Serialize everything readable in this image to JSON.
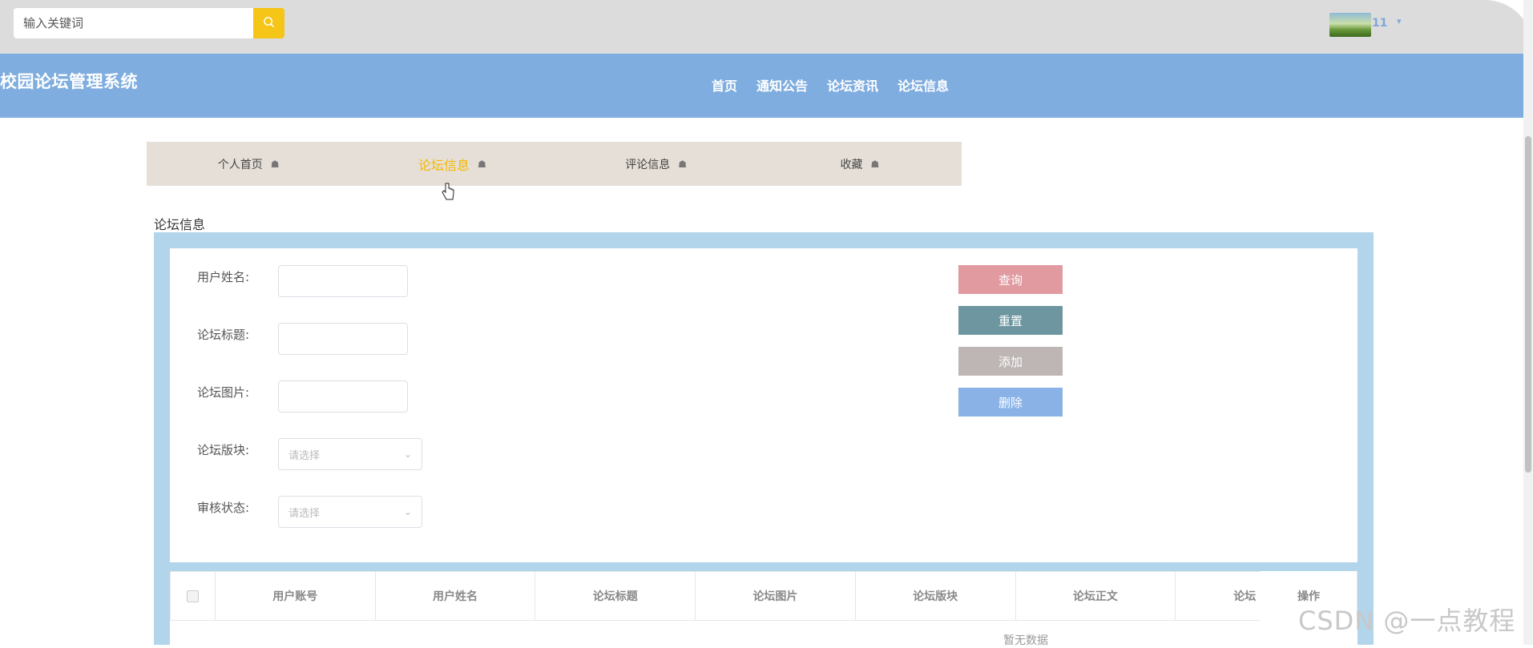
{
  "topbar": {
    "search_placeholder": "输入关键词",
    "user_name": "11"
  },
  "header": {
    "site_title": "校园论坛管理系统",
    "nav": [
      "首页",
      "通知公告",
      "论坛资讯",
      "论坛信息"
    ]
  },
  "subtabs": [
    "个人首页",
    "论坛信息",
    "评论信息",
    "收藏"
  ],
  "section_title": "论坛信息",
  "form": {
    "labels": [
      "用户姓名:",
      "论坛标题:",
      "论坛图片:",
      "论坛版块:",
      "审核状态:"
    ],
    "select_placeholder": "请选择"
  },
  "buttons": {
    "query": "查询",
    "reset": "重置",
    "add": "添加",
    "delete": "删除"
  },
  "table": {
    "columns": [
      "用户账号",
      "用户姓名",
      "论坛标题",
      "论坛图片",
      "论坛版块",
      "论坛正文",
      "论坛"
    ],
    "operation": "操作",
    "empty": "暂无数据"
  },
  "watermark": "CSDN @一点教程",
  "colors": {
    "topbar": "#dcdcdc",
    "header": "#7faddf",
    "search_button": "#f5c518",
    "active_tab": "#f5b800",
    "panel": "#b3d5eb",
    "query_button": "#e09aa0",
    "reset_button": "#6d96a0",
    "add_button": "#bdb6b5",
    "delete_button": "#8ab2e6"
  }
}
